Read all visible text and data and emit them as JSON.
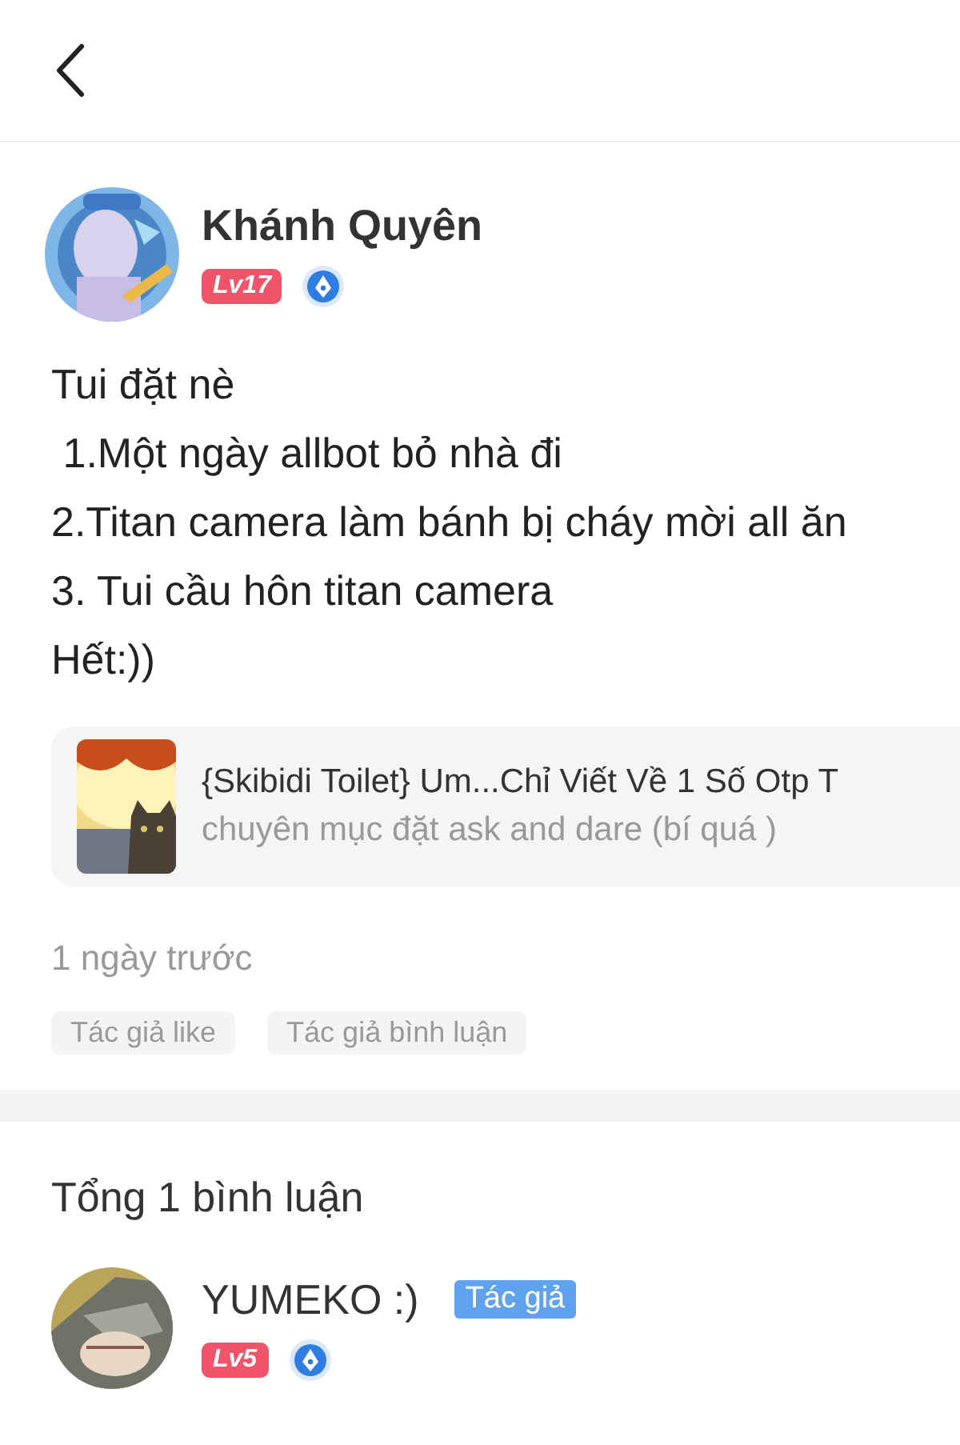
{
  "post": {
    "author": {
      "name": "Khánh Quyên",
      "level": "Lv17"
    },
    "body": "Tui đặt nè\n 1.Một ngày allbot bỏ nhà đi\n2.Titan camera làm bánh bị cháy mời all ăn\n3. Tui cầu hôn titan camera\nHết:))",
    "linked_story": {
      "title": "{Skibidi Toilet} Um...Chỉ Viết Về 1 Số Otp T",
      "subtitle": "chuyên mục đặt ask and dare (bí quá )"
    },
    "time": "1 ngày trước",
    "tags": [
      "Tác giả like",
      "Tác giả bình luận"
    ]
  },
  "comments": {
    "total": "Tổng 1 bình luận",
    "items": [
      {
        "name": "YUMEKO :)",
        "badge": "Tác giả",
        "level": "Lv5"
      }
    ]
  }
}
